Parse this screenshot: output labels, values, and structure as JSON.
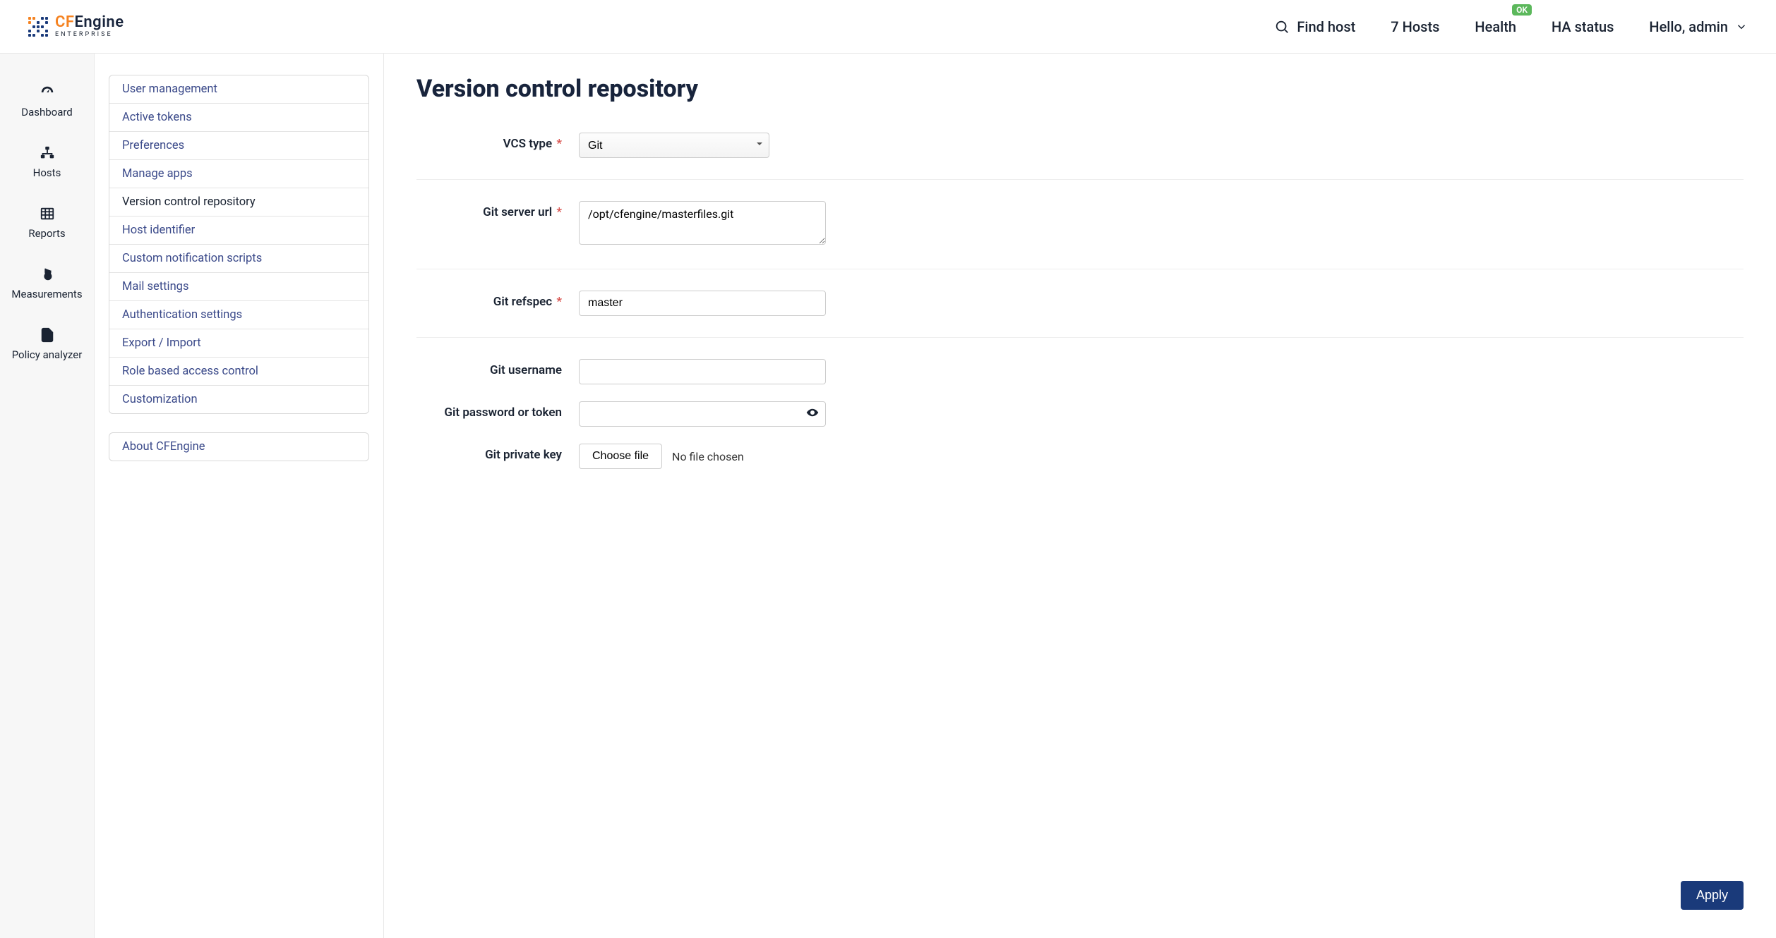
{
  "logo": {
    "cf": "CF",
    "engine": "Engine",
    "sub": "ENTERPRISE"
  },
  "header": {
    "find_host": "Find host",
    "hosts": "7 Hosts",
    "health": "Health",
    "health_badge": "OK",
    "ha_status": "HA status",
    "user_greeting": "Hello, admin"
  },
  "sidebar": {
    "items": [
      {
        "label": "Dashboard"
      },
      {
        "label": "Hosts"
      },
      {
        "label": "Reports"
      },
      {
        "label": "Measurements"
      },
      {
        "label": "Policy analyzer"
      }
    ]
  },
  "settings_nav": {
    "items": [
      {
        "label": "User management"
      },
      {
        "label": "Active tokens"
      },
      {
        "label": "Preferences"
      },
      {
        "label": "Manage apps"
      },
      {
        "label": "Version control repository",
        "active": true
      },
      {
        "label": "Host identifier"
      },
      {
        "label": "Custom notification scripts"
      },
      {
        "label": "Mail settings"
      },
      {
        "label": "Authentication settings"
      },
      {
        "label": "Export / Import"
      },
      {
        "label": "Role based access control"
      },
      {
        "label": "Customization"
      }
    ],
    "about": "About CFEngine"
  },
  "form": {
    "title": "Version control repository",
    "vcs_type_label": "VCS type",
    "vcs_type_value": "Git",
    "git_url_label": "Git server url",
    "git_url_value": "/opt/cfengine/masterfiles.git",
    "git_refspec_label": "Git refspec",
    "git_refspec_value": "master",
    "git_username_label": "Git username",
    "git_username_value": "",
    "git_password_label": "Git password or token",
    "git_password_value": "",
    "git_private_key_label": "Git private key",
    "choose_file_label": "Choose file",
    "no_file_label": "No file chosen",
    "apply_label": "Apply"
  }
}
